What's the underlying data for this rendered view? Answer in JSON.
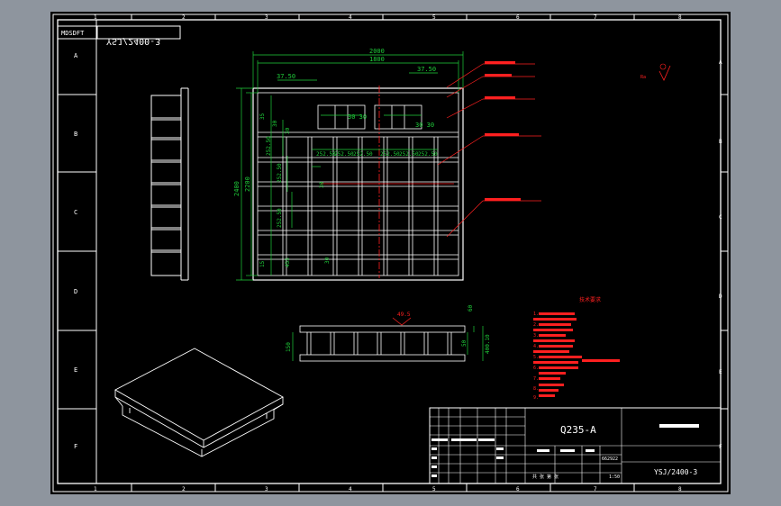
{
  "drawing": {
    "code_stamp": "MDSDFT",
    "mirrored_title": "YSJ/2400-3",
    "material": "Q235-A",
    "drawing_number": "YSJ/2400-3",
    "mark_text": "Ra",
    "row_letters": [
      "A",
      "B",
      "C",
      "D",
      "E",
      "F"
    ],
    "col_numbers": [
      "1",
      "2",
      "3",
      "4",
      "5",
      "6",
      "7",
      "8"
    ]
  },
  "dimensions": {
    "total_width": "2000",
    "inner_width": "1800",
    "left_offset": "37.50",
    "right_offset": "37.50",
    "pitch_left": "30 30",
    "pitch_right": "30 30",
    "total_height": "2400",
    "inner_height": "2200",
    "row_pitches": [
      "252.50",
      "252.50",
      "252.50",
      "252.50",
      "252.50",
      "252.50",
      "252.50"
    ],
    "col_pitch": "252.50",
    "small_dims": [
      "35",
      "30",
      "30",
      "30",
      "30",
      "30",
      "15",
      "455"
    ],
    "section_height": "150",
    "section_inner": "50",
    "section_depth": "60",
    "section_total": "400.10",
    "section_angle": "49.5"
  },
  "notes": {
    "heading": "技术要求",
    "items": [
      "1.",
      "2.",
      "3.",
      "4.",
      "5.",
      "6.",
      "7.",
      "8.",
      "9."
    ]
  },
  "title_block": {
    "scale": "1:50",
    "weight": "662922",
    "sheet": "共 张 第 张"
  },
  "colors": {
    "background": "#000000",
    "outline": "#ffffff",
    "dimension": "#1fcf3a",
    "leader": "#ff2020",
    "view": "#ffffff"
  }
}
